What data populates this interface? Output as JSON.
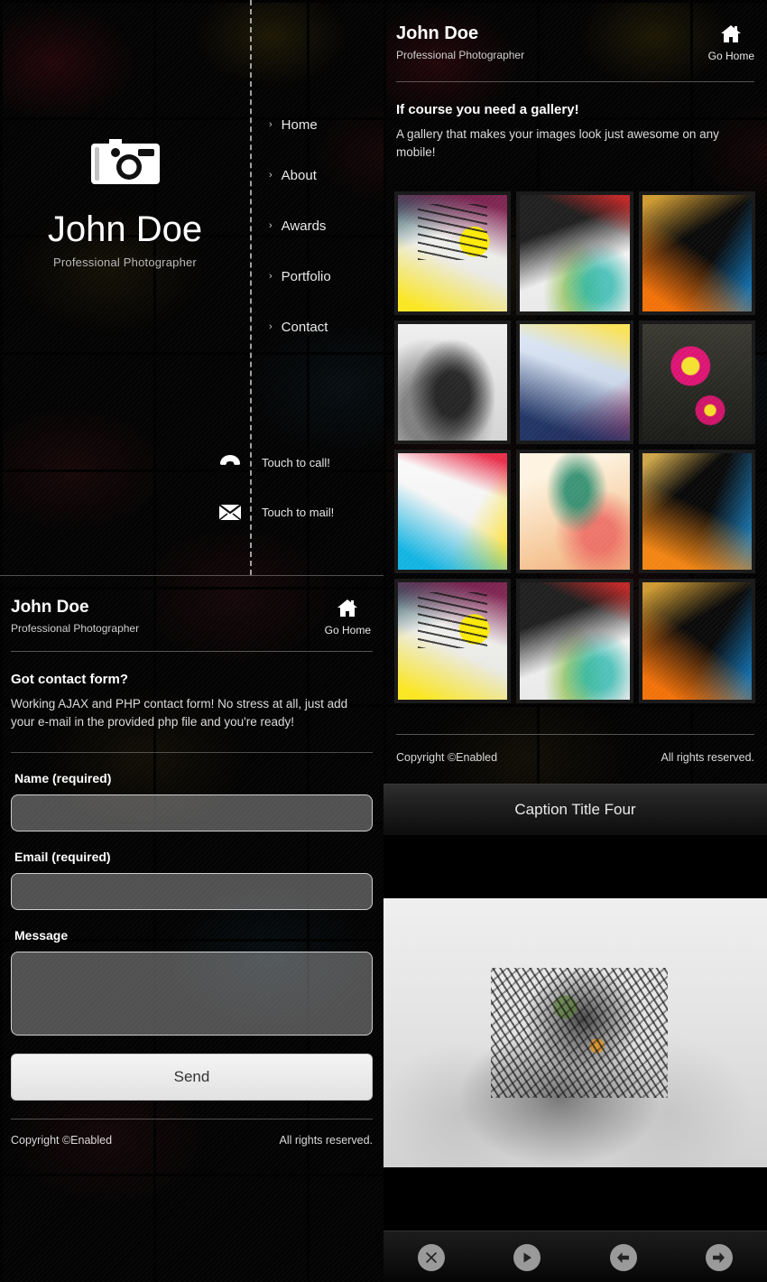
{
  "left": {
    "hero": {
      "icon": "camera-icon",
      "name": "John Doe",
      "subtitle": "Professional Photographer"
    },
    "nav": {
      "chevron": "›",
      "items": [
        {
          "label": "Home"
        },
        {
          "label": "About"
        },
        {
          "label": "Awards"
        },
        {
          "label": "Portfolio"
        },
        {
          "label": "Contact"
        }
      ]
    },
    "touch": [
      {
        "icon": "phone-icon",
        "label": "Touch to call!"
      },
      {
        "icon": "mail-icon",
        "label": "Touch to mail!"
      }
    ],
    "identity": {
      "name": "John Doe",
      "subtitle": "Professional Photographer",
      "go_home_label": "Go Home",
      "go_home_icon": "home-icon"
    },
    "contact": {
      "heading": "Got contact form?",
      "body": "Working AJAX and PHP contact form! No stress at all, just add your e-mail in the provided php file and you're ready!"
    },
    "form": {
      "name_label": "Name (required)",
      "name_value": "",
      "name_placeholder": "",
      "email_label": "Email (required)",
      "email_value": "",
      "email_placeholder": "",
      "message_label": "Message",
      "message_value": "",
      "message_placeholder": "",
      "send_label": "Send"
    },
    "footer": {
      "copyright": "Copyright ©Enabled",
      "rights": "All rights reserved."
    }
  },
  "right": {
    "header": {
      "name": "John Doe",
      "subtitle": "Professional Photographer",
      "go_home_label": "Go Home",
      "go_home_icon": "home-icon"
    },
    "intro": {
      "heading": "If course you need a gallery!",
      "body": "A gallery that makes your images look just awesome on any mobile!"
    },
    "gallery": {
      "thumbs": [
        {
          "art": "a1",
          "alt": "yellow typographic splatter artwork"
        },
        {
          "art": "a2",
          "alt": "white and black fluid abstract"
        },
        {
          "art": "a3",
          "alt": "orange and blue light streak abstract"
        },
        {
          "art": "a4",
          "alt": "grayscale ruined structure photo"
        },
        {
          "art": "a5",
          "alt": "blue and yellow ribbon abstract"
        },
        {
          "art": "a6",
          "alt": "magenta and yellow circle grunge"
        },
        {
          "art": "a7",
          "alt": "cyan red paint splash on white"
        },
        {
          "art": "a8",
          "alt": "warm peach gradient splatter"
        },
        {
          "art": "a9",
          "alt": "orange blue flare abstract"
        },
        {
          "art": "a1",
          "alt": "yellow typographic splatter artwork"
        },
        {
          "art": "a2",
          "alt": "white and black fluid abstract"
        },
        {
          "art": "a3",
          "alt": "orange and blue light streak abstract"
        }
      ]
    },
    "footer": {
      "copyright": "Copyright ©Enabled",
      "rights": "All rights reserved."
    }
  },
  "lightbox": {
    "caption": "Caption Title Four",
    "image_alt": "grayscale surreal ruined city photograph",
    "toolbar": [
      {
        "icon": "close-icon",
        "name": "close-button"
      },
      {
        "icon": "play-icon",
        "name": "play-button"
      },
      {
        "icon": "arrow-left-icon",
        "name": "previous-button"
      },
      {
        "icon": "arrow-right-icon",
        "name": "next-button"
      }
    ]
  },
  "colors": {
    "background": "#080707",
    "text": "#ffffff",
    "muted_text": "#dcdcdc",
    "rule": "#4d4d4d",
    "send_button": "#ebebeb",
    "toolbar_icon": "#9a9a9a"
  }
}
